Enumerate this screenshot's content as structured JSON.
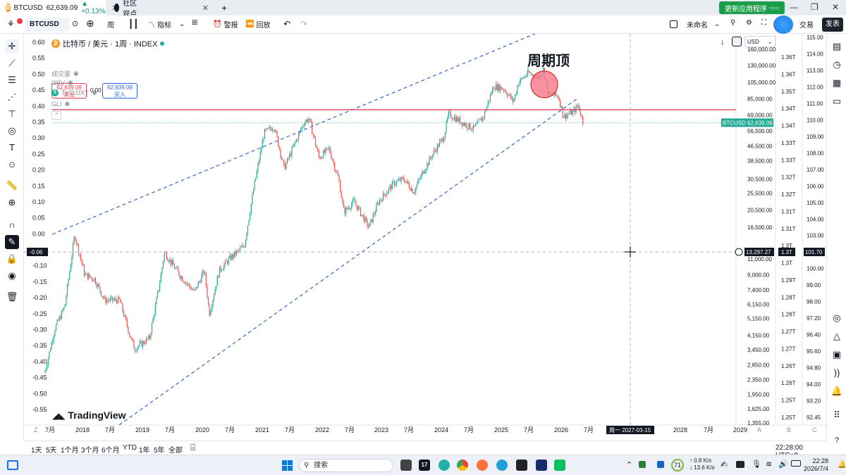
{
  "browser": {
    "tabs": [
      {
        "title": "BTCUSD",
        "price": "62,639.09",
        "change": "▲ +0.13%"
      },
      {
        "title": "社区观点"
      }
    ],
    "new_tab": "+",
    "update_button": "更新应用程序",
    "window_controls": [
      "—",
      "❐",
      "✕"
    ]
  },
  "toolbar": {
    "symbol": "BTCUSD",
    "interval": "周",
    "indicators": "指标",
    "alert": "警报",
    "replay": "回放",
    "layout_name": "未命名",
    "trade": "交易",
    "publish": "发表"
  },
  "legend": {
    "title": "比特币 / 美元 · 1周 · INDEX",
    "sell_price": "62,639.09",
    "sell_label": "卖出",
    "spread": "0.00",
    "buy_price": "62,639.09",
    "buy_label": "买入",
    "indicators": [
      "成交量",
      "OBV",
      "TVC:DXY",
      "GLI"
    ]
  },
  "annotation": {
    "text": "周期顶"
  },
  "chart_data": {
    "type": "candlestick",
    "symbol": "BTCUSD",
    "interval": "1W",
    "price_scale": "log",
    "last_price": 62639.09,
    "y_price_ticks": [
      "160,000.00",
      "130,000.00",
      "105,000.00",
      "85,000.00",
      "69,000.00",
      "56,500.00",
      "46,500.00",
      "38,500.00",
      "30,500.00",
      "25,500.00",
      "20,500.00",
      "16,500.00",
      "11,000.00",
      "9,000.00",
      "7,400.00",
      "6,150.00",
      "5,150.00",
      "4,150.00",
      "3,450.00",
      "2,850.00",
      "2,350.00",
      "1,950.00",
      "1,625.00",
      "1,355.00"
    ],
    "y_left_ticks": [
      "0.60",
      "0.55",
      "0.50",
      "0.45",
      "0.40",
      "0.35",
      "0.30",
      "0.25",
      "0.20",
      "0.15",
      "0.10",
      "0.05",
      "0.00",
      "-0.10",
      "-0.15",
      "-0.20",
      "-0.25",
      "-0.30",
      "-0.35",
      "-0.40",
      "-0.45",
      "-0.50",
      "-0.55"
    ],
    "y_left_crosshair": "-0.06",
    "y_gli_ticks": [
      "1.36T",
      "1.36T",
      "1.35T",
      "1.34T",
      "1.34T",
      "1.33T",
      "1.33T",
      "1.32T",
      "1.32T",
      "1.31T",
      "1.31T",
      "1.3T",
      "1.3T",
      "1.29T",
      "1.28T",
      "1.28T",
      "1.27T",
      "1.27T",
      "1.26T",
      "1.26T",
      "1.25T",
      "1.25T"
    ],
    "y_dxy_ticks": [
      "115.00",
      "114.00",
      "113.00",
      "112.00",
      "111.00",
      "110.00",
      "109.00",
      "108.00",
      "107.00",
      "106.00",
      "105.00",
      "104.00",
      "103.00",
      "101.00",
      "100.00",
      "99.00",
      "98.00",
      "97.20",
      "96.40",
      "95.60",
      "94.80",
      "94.00",
      "93.20",
      "92.45"
    ],
    "x_ticks": [
      "7月",
      "2018",
      "7月",
      "2019",
      "7月",
      "2020",
      "7月",
      "2021",
      "7月",
      "2022",
      "7月",
      "2023",
      "7月",
      "2024",
      "7月",
      "2025",
      "7月",
      "2026",
      "7月",
      "2028",
      "7月",
      "2029"
    ],
    "crosshair_date": "周一 2027-03-15",
    "crosshair_price": "13,297.27",
    "crosshair_gli": "1.3T",
    "crosshair_dxy": "101.70",
    "last_price_label": "62,639.09",
    "resistance_level": 74000,
    "price_unit": "USD",
    "scale_letters": [
      "A",
      "B",
      "C"
    ],
    "axis_start_letter": "Z",
    "prices": [
      [
        "2017-06",
        2600
      ],
      [
        "2017-08",
        4500
      ],
      [
        "2017-10",
        6000
      ],
      [
        "2017-12",
        15000
      ],
      [
        "2018-02",
        9000
      ],
      [
        "2018-04",
        8500
      ],
      [
        "2018-06",
        6500
      ],
      [
        "2018-09",
        6500
      ],
      [
        "2018-11",
        4200
      ],
      [
        "2018-12",
        3500
      ],
      [
        "2019-03",
        4000
      ],
      [
        "2019-05",
        8000
      ],
      [
        "2019-06",
        12000
      ],
      [
        "2019-09",
        9000
      ],
      [
        "2019-12",
        7200
      ],
      [
        "2020-02",
        9500
      ],
      [
        "2020-03",
        5500
      ],
      [
        "2020-05",
        9500
      ],
      [
        "2020-07",
        11000
      ],
      [
        "2020-10",
        13000
      ],
      [
        "2020-12",
        28000
      ],
      [
        "2021-02",
        55000
      ],
      [
        "2021-04",
        60000
      ],
      [
        "2021-06",
        35000
      ],
      [
        "2021-08",
        47000
      ],
      [
        "2021-10",
        63000
      ],
      [
        "2021-11",
        66000
      ],
      [
        "2022-01",
        40000
      ],
      [
        "2022-03",
        45000
      ],
      [
        "2022-05",
        30000
      ],
      [
        "2022-06",
        20000
      ],
      [
        "2022-08",
        23000
      ],
      [
        "2022-11",
        16500
      ],
      [
        "2023-01",
        23000
      ],
      [
        "2023-04",
        29000
      ],
      [
        "2023-06",
        30500
      ],
      [
        "2023-08",
        26000
      ],
      [
        "2023-10",
        34000
      ],
      [
        "2023-12",
        43000
      ],
      [
        "2024-02",
        52000
      ],
      [
        "2024-03",
        70000
      ],
      [
        "2024-06",
        62000
      ],
      [
        "2024-08",
        58000
      ],
      [
        "2024-10",
        68000
      ],
      [
        "2024-12",
        100000
      ],
      [
        "2025-02",
        97000
      ],
      [
        "2025-04",
        82000
      ],
      [
        "2025-05",
        105000
      ],
      [
        "2025-07",
        118000
      ],
      [
        "2025-09",
        112000
      ],
      [
        "2025-10",
        124000
      ],
      [
        "2025-11",
        90000
      ],
      [
        "2026-01",
        88000
      ],
      [
        "2026-02",
        68000
      ],
      [
        "2026-04",
        72000
      ],
      [
        "2026-05",
        78000
      ],
      [
        "2026-06",
        62639
      ]
    ]
  },
  "watermark": "TradingView",
  "timeframes": [
    "1天",
    "5天",
    "1个月",
    "3个月",
    "6个月",
    "YTD",
    "1年",
    "5年",
    "全部"
  ],
  "time_display": "22:28:00 UTC+8",
  "taskbar": {
    "search": "搜索",
    "weather": "71",
    "net_up": "0.8 K/s",
    "net_down": "13.6 K/s",
    "clock_time": "22:28",
    "clock_date": "2026/7/4"
  },
  "colors": {
    "up": "#26a69a",
    "down": "#ef5350",
    "channel": "#3366cc",
    "resistance": "#e0435a",
    "annotation": "#f77f8f"
  }
}
